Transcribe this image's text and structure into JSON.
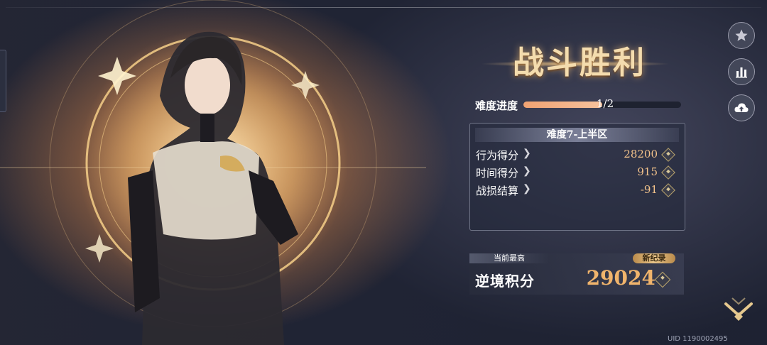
{
  "result": {
    "title": "战斗胜利"
  },
  "progress": {
    "label": "难度进度",
    "text": "1/2",
    "fraction": 0.5
  },
  "panel": {
    "header": "难度7-上半区",
    "rows": [
      {
        "label": "行为得分",
        "value": "28200"
      },
      {
        "label": "时间得分",
        "value": "915"
      },
      {
        "label": "战损结算",
        "value": "-91"
      }
    ]
  },
  "best": {
    "tag": "当前最高",
    "badge": "新纪录",
    "label": "逆境积分",
    "score": "29024"
  },
  "side_icons": [
    "star-icon",
    "bar-chart-icon",
    "cloud-upload-icon"
  ],
  "confirm_icon": "chevron-down-icon",
  "uid": "UID 1190002495",
  "colors": {
    "accent": "#f0b46c",
    "progress": "#f0a272",
    "title": "#f4dcae"
  }
}
